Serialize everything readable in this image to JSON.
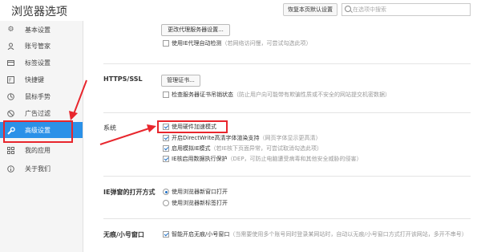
{
  "window": {
    "title": "浏览器选项",
    "restore_label": "恢复本页默认设置",
    "search_placeholder": "在选项中搜索"
  },
  "sidebar": {
    "items": [
      {
        "label": "基本设置",
        "icon": "gear-icon"
      },
      {
        "label": "账号管家",
        "icon": "user-icon"
      },
      {
        "label": "标签设置",
        "icon": "tag-icon"
      },
      {
        "label": "快捷键",
        "icon": "keyboard-icon"
      },
      {
        "label": "鼠标手势",
        "icon": "mouse-icon"
      },
      {
        "label": "广告过滤",
        "icon": "block-icon"
      },
      {
        "label": "高级设置",
        "icon": "wrench-icon"
      },
      {
        "label": "我的应用",
        "icon": "apps-icon"
      },
      {
        "label": "关于我们",
        "icon": "info-icon"
      }
    ],
    "active_index": 6,
    "active_color": "#2b91e8"
  },
  "proxy": {
    "button_label": "更改代理服务器设置...",
    "option_label": "使用IE代理自动检测",
    "option_hint": "（若网络访问慢，可尝试勾选此项）",
    "option_checked": false
  },
  "https": {
    "label": "HTTPS/SSL",
    "button_label": "管理证书...",
    "option_label": "检查服务器证书吊销状态",
    "option_hint": "（防止用户向可能带有欺骗性质或不安全的网站提交机密数据）",
    "option_checked": false
  },
  "system": {
    "label": "系统",
    "options": [
      {
        "label": "使用硬件加速模式",
        "hint": "",
        "checked": true
      },
      {
        "label": "开启DirectWrite高清字体渲染支持",
        "hint": "（网页字体显示更高清）",
        "checked": true
      },
      {
        "label": "启用模拟IE模式",
        "hint": "（若IE核下页面异常，可尝试取消勾选此项）",
        "checked": true
      },
      {
        "label": "IE核启用数据执行保护",
        "hint": "（DEP，可防止电脑遭受病毒和其他安全威胁的侵害）",
        "checked": true
      }
    ]
  },
  "ie_popup": {
    "label": "IE弹窗的打开方式",
    "options": [
      {
        "label": "使用浏览器新窗口打开",
        "selected": true
      },
      {
        "label": "使用浏览器新标签打开",
        "selected": false
      }
    ]
  },
  "traceless": {
    "label": "无痕/小号窗口",
    "option_label": "智能开启无痕/小号窗口",
    "option_hint": "（当需要使用多个账号同时登录某网站时，自动以无痕/小号窗口方式打开该网站，多开不串号）",
    "option_checked": true
  },
  "annotation_color": "#e8262d"
}
